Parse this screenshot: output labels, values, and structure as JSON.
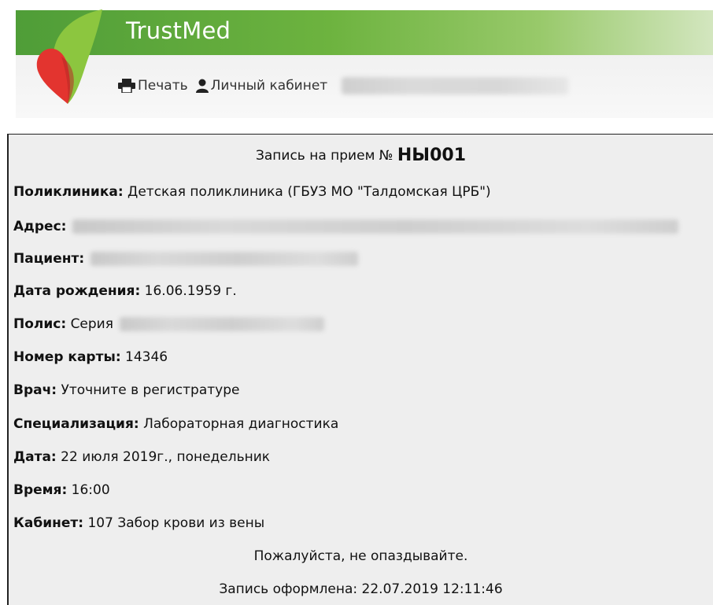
{
  "app": {
    "brand": "TrustMed",
    "colors": {
      "brand_green": "#6db33f",
      "logo_green": "#8cc63f",
      "logo_red": "#e3342f",
      "content_bg": "#eeeeee"
    }
  },
  "toolbar": {
    "print_label": "Печать",
    "print_icon": "printer-icon",
    "cabinet_label": "Личный кабинет",
    "cabinet_icon": "user-icon"
  },
  "record": {
    "title_prefix": "Запись на прием №",
    "number": "НЫ001",
    "fields": {
      "clinic_label": "Поликлиника:",
      "clinic_value": "Детская поликлиника (ГБУЗ МО \"Талдомская ЦРБ\")",
      "address_label": "Адрес:",
      "patient_label": "Пациент:",
      "birth_label": "Дата рождения:",
      "birth_value": "16.06.1959 г.",
      "policy_label": "Полис:",
      "policy_value": "Серия",
      "card_label": "Номер карты:",
      "card_value": "14346",
      "doctor_label": "Врач:",
      "doctor_value": "Уточните в регистратуре",
      "spec_label": "Специализация:",
      "spec_value": "Лабораторная диагностика",
      "date_label": "Дата:",
      "date_value": "22 июля 2019г., понедельник",
      "time_label": "Время:",
      "time_value": "16:00",
      "room_label": "Кабинет:",
      "room_value": "107 Забор крови из вены"
    },
    "notice": "Пожалуйста, не опаздывайте.",
    "created_label": "Запись оформлена:",
    "created_value": "22.07.2019 12:11:46"
  }
}
